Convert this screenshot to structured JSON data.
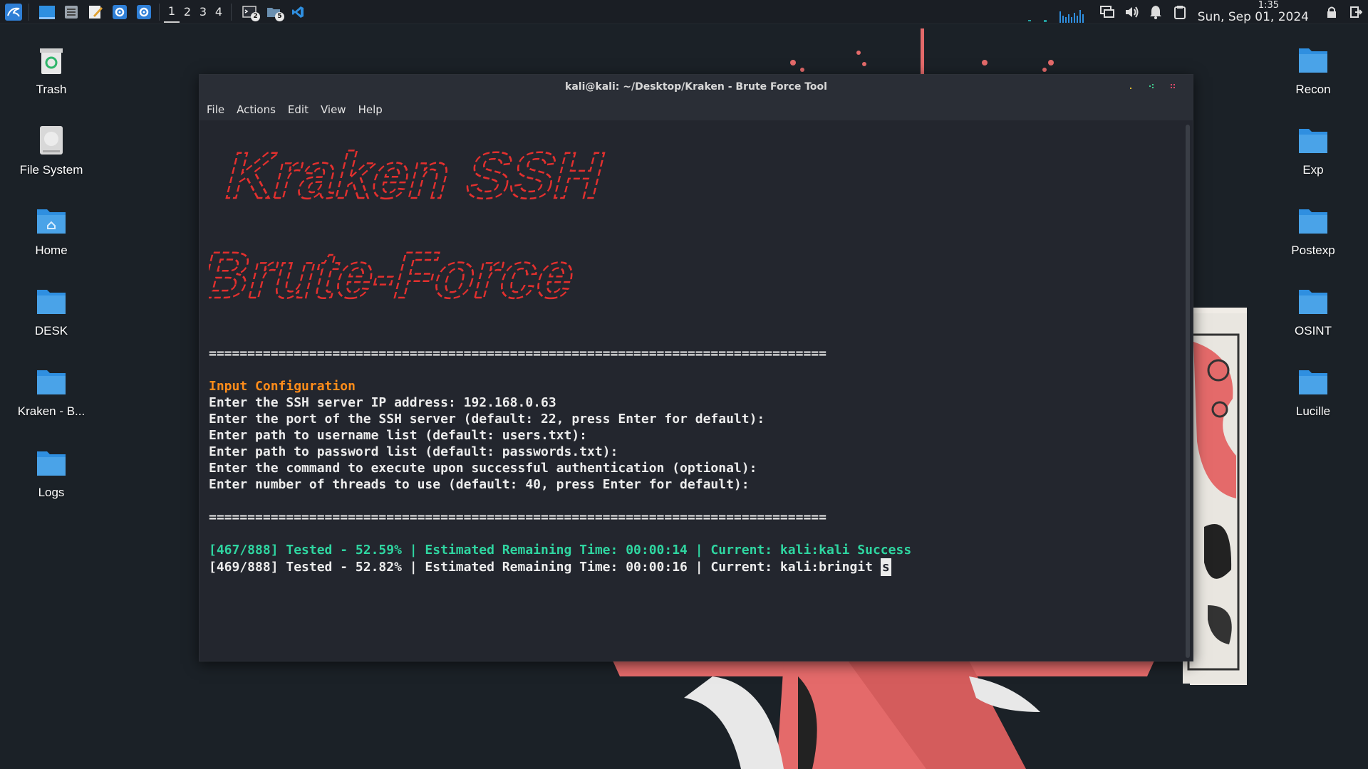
{
  "panel": {
    "workspaces": [
      "1",
      "2",
      "3",
      "4"
    ],
    "active_workspace": "1",
    "terminal_badge": "2",
    "files_badge": "5",
    "clock_time": "1:35",
    "clock_date": "Sun, Sep 01, 2024"
  },
  "desktop_left": [
    {
      "label": "Trash",
      "icon": "trash-icon"
    },
    {
      "label": "File System",
      "icon": "drive-icon"
    },
    {
      "label": "Home",
      "icon": "home-folder-icon"
    },
    {
      "label": "DESK",
      "icon": "folder-icon"
    },
    {
      "label": "Kraken - B...",
      "icon": "folder-icon"
    },
    {
      "label": "Logs",
      "icon": "folder-icon"
    }
  ],
  "desktop_right": [
    {
      "label": "Recon",
      "icon": "folder-icon"
    },
    {
      "label": "Exp",
      "icon": "folder-icon"
    },
    {
      "label": "Postexp",
      "icon": "folder-icon"
    },
    {
      "label": "OSINT",
      "icon": "folder-icon"
    },
    {
      "label": "Lucille",
      "icon": "folder-icon"
    }
  ],
  "terminal": {
    "title": "kali@kali: ~/Desktop/Kraken - Brute Force Tool",
    "menu": [
      "File",
      "Actions",
      "Edit",
      "View",
      "Help"
    ],
    "banner_line1": "Kraken SSH",
    "banner_line2": "Brute-Force",
    "separator": "================================================================================",
    "section_header": "Input Configuration",
    "prompts": [
      "Enter the SSH server IP address: 192.168.0.63",
      "Enter the port of the SSH server (default: 22, press Enter for default):",
      "Enter path to username list (default: users.txt):",
      "Enter path to password list (default: passwords.txt):",
      "Enter the command to execute upon successful authentication (optional):",
      "Enter number of threads to use (default: 40, press Enter for default):"
    ],
    "progress_success": "[467/888] Tested - 52.59% | Estimated Remaining Time: 00:00:14 | Current: kali:kali Success",
    "progress_current": "[469/888] Tested - 52.82% | Estimated Remaining Time: 00:00:16 | Current: kali:bringit ",
    "cursor_char": "s"
  },
  "colors": {
    "banner_red": "#e3302e",
    "accent_orange": "#ff8c1a",
    "success_green": "#2fd6a1",
    "folder_blue": "#4aa3e8"
  }
}
